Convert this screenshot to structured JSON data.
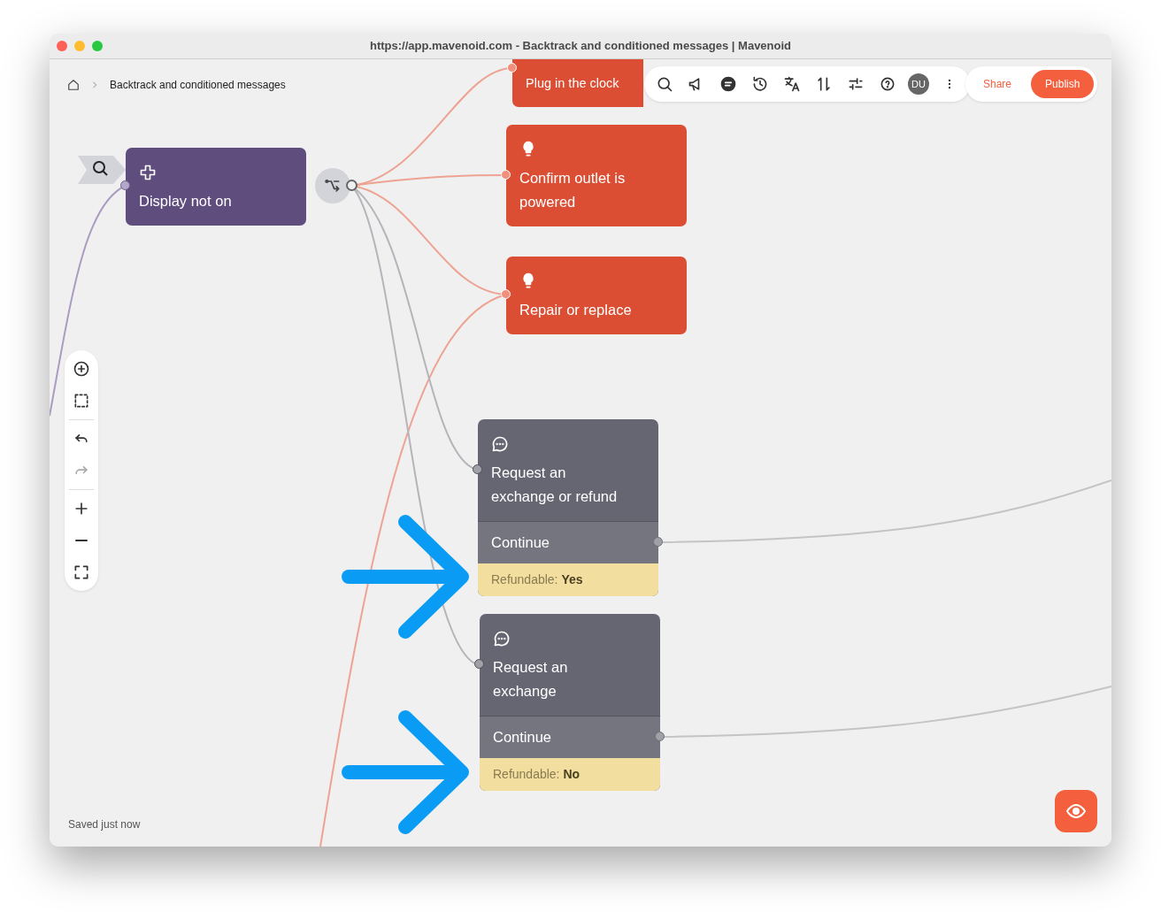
{
  "window": {
    "title": "https://app.mavenoid.com - Backtrack and conditioned messages | Mavenoid"
  },
  "breadcrumb": {
    "current": "Backtrack and conditioned messages"
  },
  "toolbar": {
    "avatar": "DU"
  },
  "actions": [
    {
      "label": "Share",
      "kind": "secondary"
    },
    {
      "label": "Publish",
      "kind": "primary"
    }
  ],
  "nodes": [
    {
      "kind": "tip",
      "label": "Plug in the clock"
    },
    {
      "kind": "start",
      "label": "Display not on"
    },
    {
      "kind": "tip",
      "label": "Confirm outlet is powered"
    },
    {
      "kind": "tip",
      "label": "Repair or replace"
    },
    {
      "kind": "message",
      "label": "Request an exchange or refund",
      "answer": "Continue",
      "condition": "Refundable: **Yes**"
    },
    {
      "kind": "message",
      "label": "Request an exchange",
      "answer": "Continue",
      "condition": "Refundable: **No**"
    }
  ],
  "status": "Saved just now"
}
